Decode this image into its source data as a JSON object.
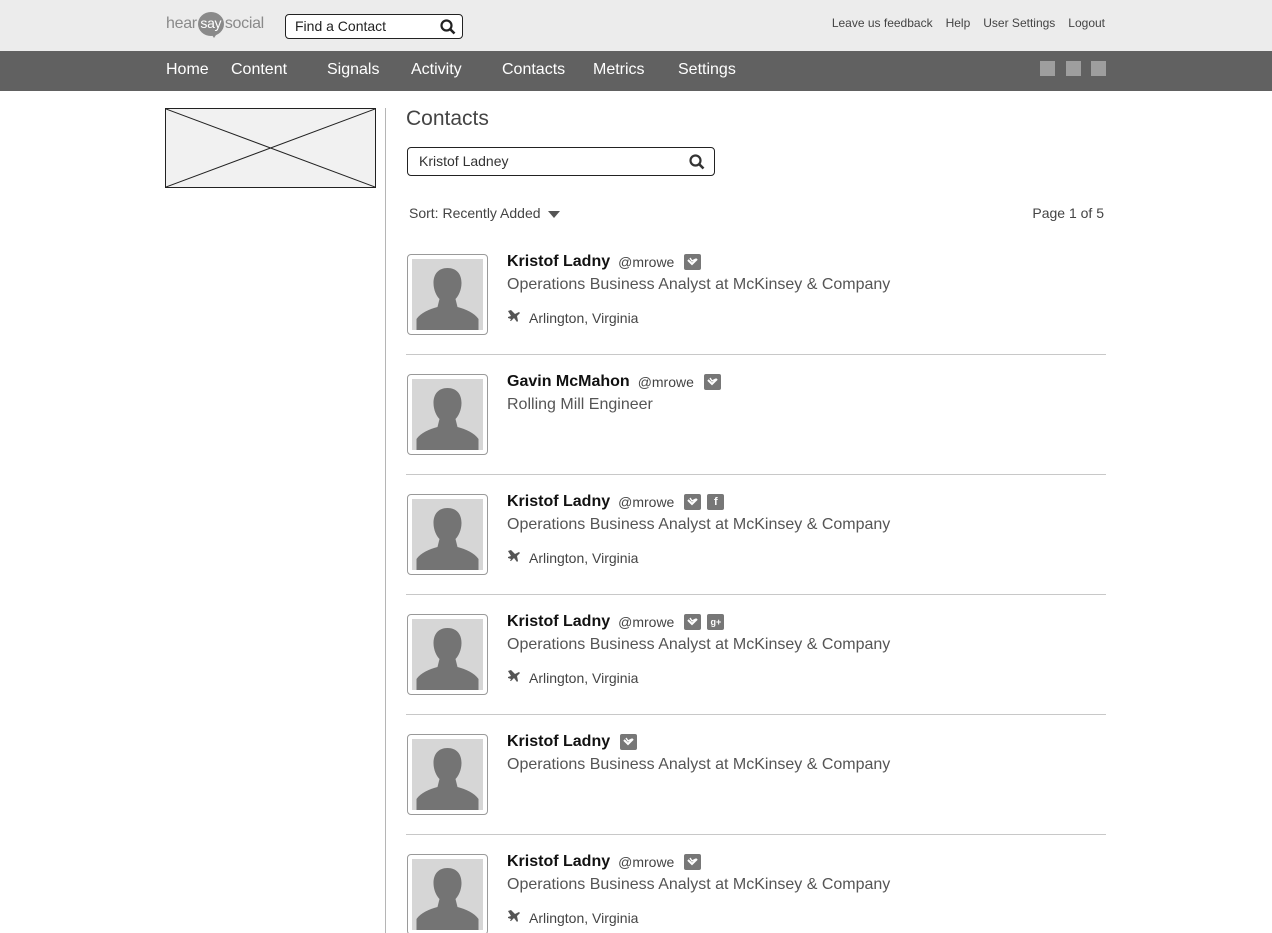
{
  "header": {
    "logo": {
      "part1": "hear",
      "part2": "say",
      "part3": "social"
    },
    "find_placeholder": "Find a Contact",
    "links": [
      "Leave us feedback",
      "Help",
      "User Settings",
      "Logout"
    ]
  },
  "nav": {
    "items": [
      "Home",
      "Content",
      "Signals",
      "Activity",
      "Contacts",
      "Metrics",
      "Settings"
    ]
  },
  "main": {
    "title": "Contacts",
    "search_value": "Kristof Ladney",
    "sort_label": "Sort: Recently Added",
    "page_info": "Page 1 of 5"
  },
  "contacts": [
    {
      "name": "Kristof Ladny",
      "handle": "@mrowe",
      "networks": [
        "twitter"
      ],
      "title": "Operations Business Analyst at McKinsey & Company",
      "location": "Arlington, Virginia"
    },
    {
      "name": "Gavin McMahon",
      "handle": "@mrowe",
      "networks": [
        "twitter"
      ],
      "title": "Rolling Mill Engineer",
      "location": ""
    },
    {
      "name": "Kristof Ladny",
      "handle": "@mrowe",
      "networks": [
        "twitter",
        "facebook"
      ],
      "title": "Operations Business Analyst at McKinsey & Company",
      "location": "Arlington, Virginia"
    },
    {
      "name": "Kristof Ladny",
      "handle": "@mrowe",
      "networks": [
        "twitter",
        "google-plus"
      ],
      "title": "Operations Business Analyst at McKinsey & Company",
      "location": "Arlington, Virginia"
    },
    {
      "name": "Kristof Ladny",
      "handle": "",
      "networks": [
        "twitter"
      ],
      "title": "Operations Business Analyst at McKinsey & Company",
      "location": ""
    },
    {
      "name": "Kristof Ladny",
      "handle": "@mrowe",
      "networks": [
        "twitter"
      ],
      "title": "Operations Business Analyst at McKinsey & Company",
      "location": "Arlington, Virginia"
    }
  ],
  "icons": {
    "social_fb_glyph": "f",
    "social_gplus_glyph": "g+"
  },
  "colors": {
    "topbar": "#ececec",
    "navbar": "#616161",
    "icon_gray": "#777777"
  }
}
